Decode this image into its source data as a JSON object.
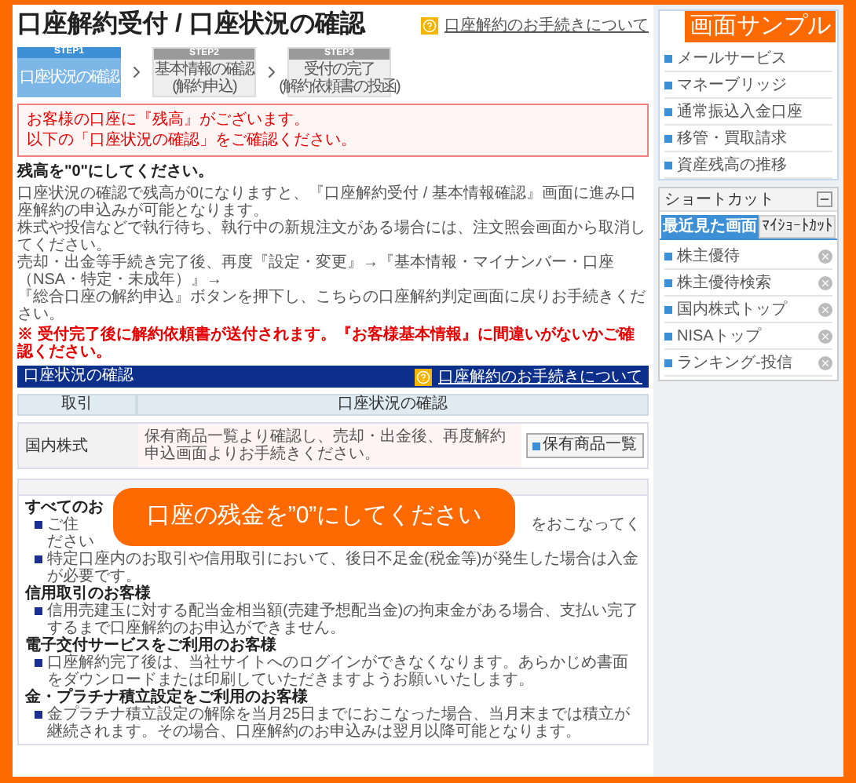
{
  "page_title": "口座解約受付 / 口座状況の確認",
  "help_link": "口座解約のお手続きについて",
  "steps": [
    {
      "label": "STEP1",
      "lines": [
        "口座状況の確認"
      ],
      "selected": true
    },
    {
      "label": "STEP2",
      "lines": [
        "基本情報の確認",
        "(解約申込)"
      ],
      "selected": false
    },
    {
      "label": "STEP3",
      "lines": [
        "受付の完了",
        "(解約依頼書の投函)"
      ],
      "selected": false
    }
  ],
  "alert": [
    "お客様の口座に『残高』がございます。",
    "以下の「口座状況の確認」をご確認ください。"
  ],
  "notice": {
    "heading": "残高を\"0\"にしてください。",
    "lines": [
      "口座状況の確認で残高が0になりますと、『口座解約受付 / 基本情報確認』画面に進み口座解約の申込みが可能となります。",
      "株式や投信などで執行待ち、執行中の新規注文がある場合には、注文照会画面から取消してください。",
      "売却・出金等手続き完了後、再度『設定・変更』→『基本情報・マイナンバー・口座（NSA・特定・未成年）』→",
      "『総合口座の解約申込』ボタンを押下し、こちらの口座解約判定画面に戻りお手続きください。"
    ],
    "warning": "※ 受付完了後に解約依頼書が送付されます。『お客様基本情報』に間違いがないかご確認ください。"
  },
  "status_section": {
    "title": "口座状況の確認",
    "help_link": "口座解約のお手続きについて",
    "columns": [
      "取引",
      "口座状況の確認"
    ],
    "rows": [
      {
        "product": "国内株式",
        "message": "保有商品一覧より確認し、売却・出金後、再度解約申込画面よりお手続きください。",
        "button": "保有商品一覧"
      }
    ]
  },
  "cautions": [
    {
      "heading": "すべてのお",
      "items": [
        {
          "kind": "split",
          "parts": [
            "ご住",
            "をおこなってく"
          ],
          "continuation": "ださい"
        },
        {
          "kind": "text",
          "text": "特定口座内のお取引や信用取引において、後日不足金(税金等)が発生した場合は入金が必要です。"
        }
      ]
    },
    {
      "heading": "信用取引のお客様",
      "items": [
        {
          "kind": "text",
          "text": "信用売建玉に対する配当金相当額(売建予想配当金)の拘束金がある場合、支払い完了するまで口座解約のお申込ができません。"
        }
      ]
    },
    {
      "heading": "電子交付サービスをご利用のお客様",
      "items": [
        {
          "kind": "text",
          "text": "口座解約完了後は、当社サイトへのログインができなくなります。あらかじめ書面をダウンロードまたは印刷していただきますようお願いいたします。"
        }
      ]
    },
    {
      "heading": "金・プラチナ積立設定をご利用のお客様",
      "items": [
        {
          "kind": "text",
          "text": "金プラチナ積立設定の解除を当月25日までにおこなった場合、当月末までは積立が継続されます。その場合、口座解約のお申込みは翌月以降可能となります。"
        }
      ]
    }
  ],
  "callout": "口座の残金を”0”にしてください",
  "sidebar": {
    "menu": [
      "メールサービス",
      "マネーブリッジ",
      "通常振込入金口座",
      "移管・買取請求",
      "資産残高の推移"
    ],
    "shortcut": {
      "title": "ショートカット",
      "tabs": [
        {
          "label": "最近見た画面",
          "selected": true
        },
        {
          "label": "ﾏｲｼｮｰﾄｶｯﾄ",
          "selected": false
        }
      ],
      "items": [
        "株主優待",
        "株主優待検索",
        "国内株式トップ",
        "NISAトップ",
        "ランキング-投信"
      ]
    }
  },
  "sample_badge": "画面サンプル"
}
